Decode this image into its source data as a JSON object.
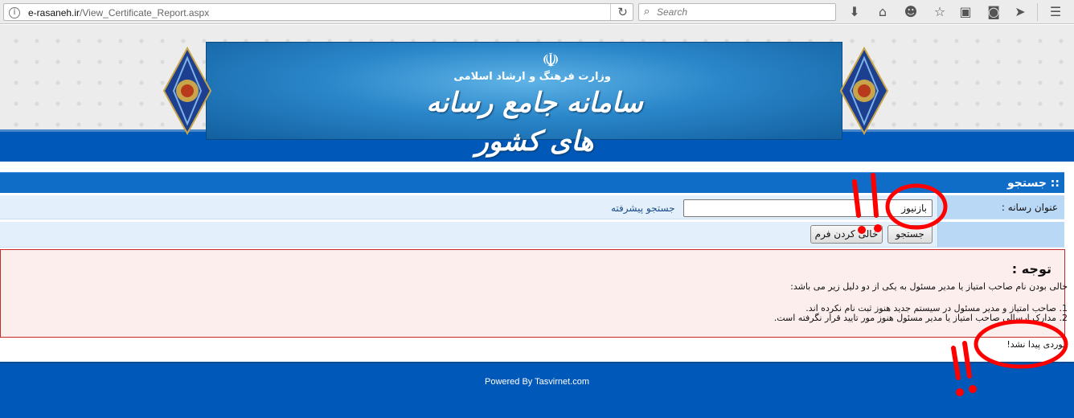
{
  "browser": {
    "url_domain": "e-rasaneh.ir",
    "url_path": "/View_Certificate_Report.aspx",
    "search_placeholder": "Search"
  },
  "header": {
    "ministry": "وزارت فرهنگ و ارشاد اسلامی",
    "site_name": "سامانه جامع رسانه های کشور"
  },
  "search_panel": {
    "title": ":: جستجو",
    "media_title_label": "عنوان رسانه :",
    "media_title_value": "بازنیوز",
    "advanced_search_link": "جستجو پیشرفته",
    "search_button": "جستجو",
    "clear_button": "خالی کردن فرم"
  },
  "notice": {
    "title": "توجه :",
    "line1": "خالی بودن نام صاحب امتیاز یا مدیر مسئول به یکی از دو دلیل زیر می باشد:",
    "line2": "1. صاحب امتیاز و مدیر مسئول در سیستم جدید هنوز ثبت نام نکرده اند.",
    "line3": "2. مدارک ارسالی صاحب امتیاز یا مدیر مسئول هنوز مور تایید قرار نگرفته است."
  },
  "result_text": "موردی پیدا نشد!",
  "footer": {
    "powered_by": "Powered By Tasvirnet.com"
  },
  "colors": {
    "brand_blue": "#0058b8",
    "panel_blue": "#0f6cc7",
    "notice_border": "#c72a2a",
    "annotation_red": "#ff0000"
  }
}
